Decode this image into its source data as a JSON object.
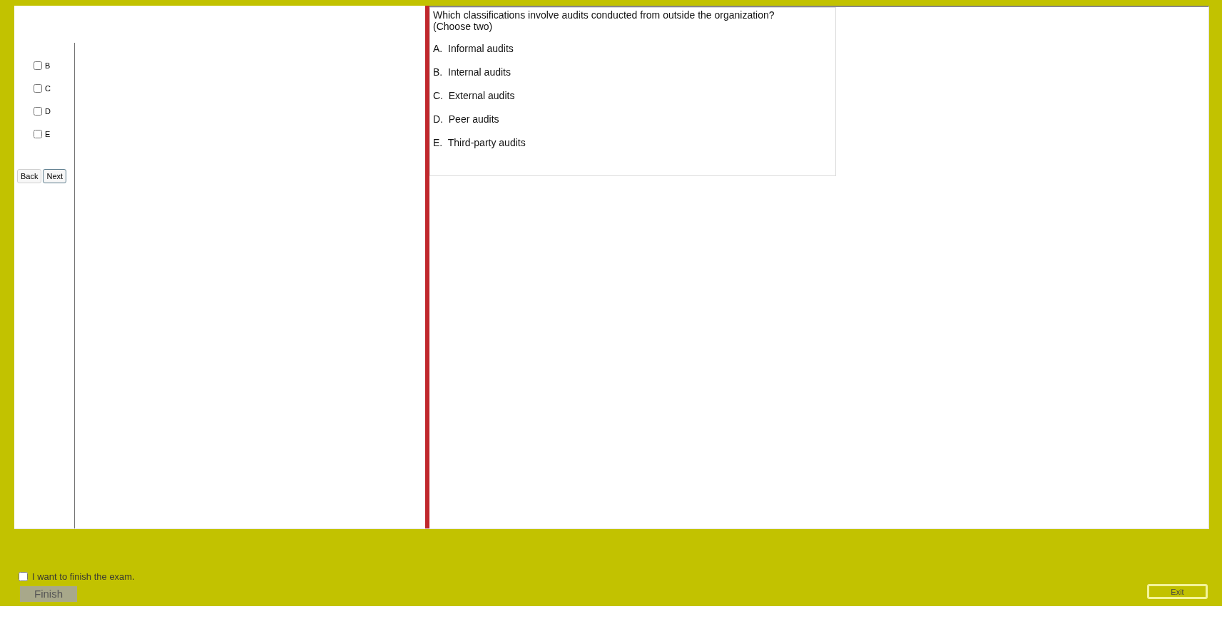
{
  "answer_options": [
    {
      "label": "B",
      "checked": false
    },
    {
      "label": "C",
      "checked": false
    },
    {
      "label": "D",
      "checked": false
    },
    {
      "label": "E",
      "checked": false
    }
  ],
  "nav_buttons": [
    "Back",
    "Next"
  ],
  "question": {
    "text": "Which classifications involve audits conducted from outside the organization?",
    "hint": "(Choose two)",
    "choices": [
      {
        "letter": "A.",
        "text": "Informal audits"
      },
      {
        "letter": "B.",
        "text": "Internal audits"
      },
      {
        "letter": "C.",
        "text": "External audits"
      },
      {
        "letter": "D.",
        "text": "Peer audits"
      },
      {
        "letter": "E.",
        "text": "Third-party audits"
      }
    ]
  },
  "footer": {
    "finish_confirm": {
      "label": "I want to finish the exam.",
      "checked": false
    },
    "finish_button": "Finish",
    "exit_button": "Exit"
  }
}
